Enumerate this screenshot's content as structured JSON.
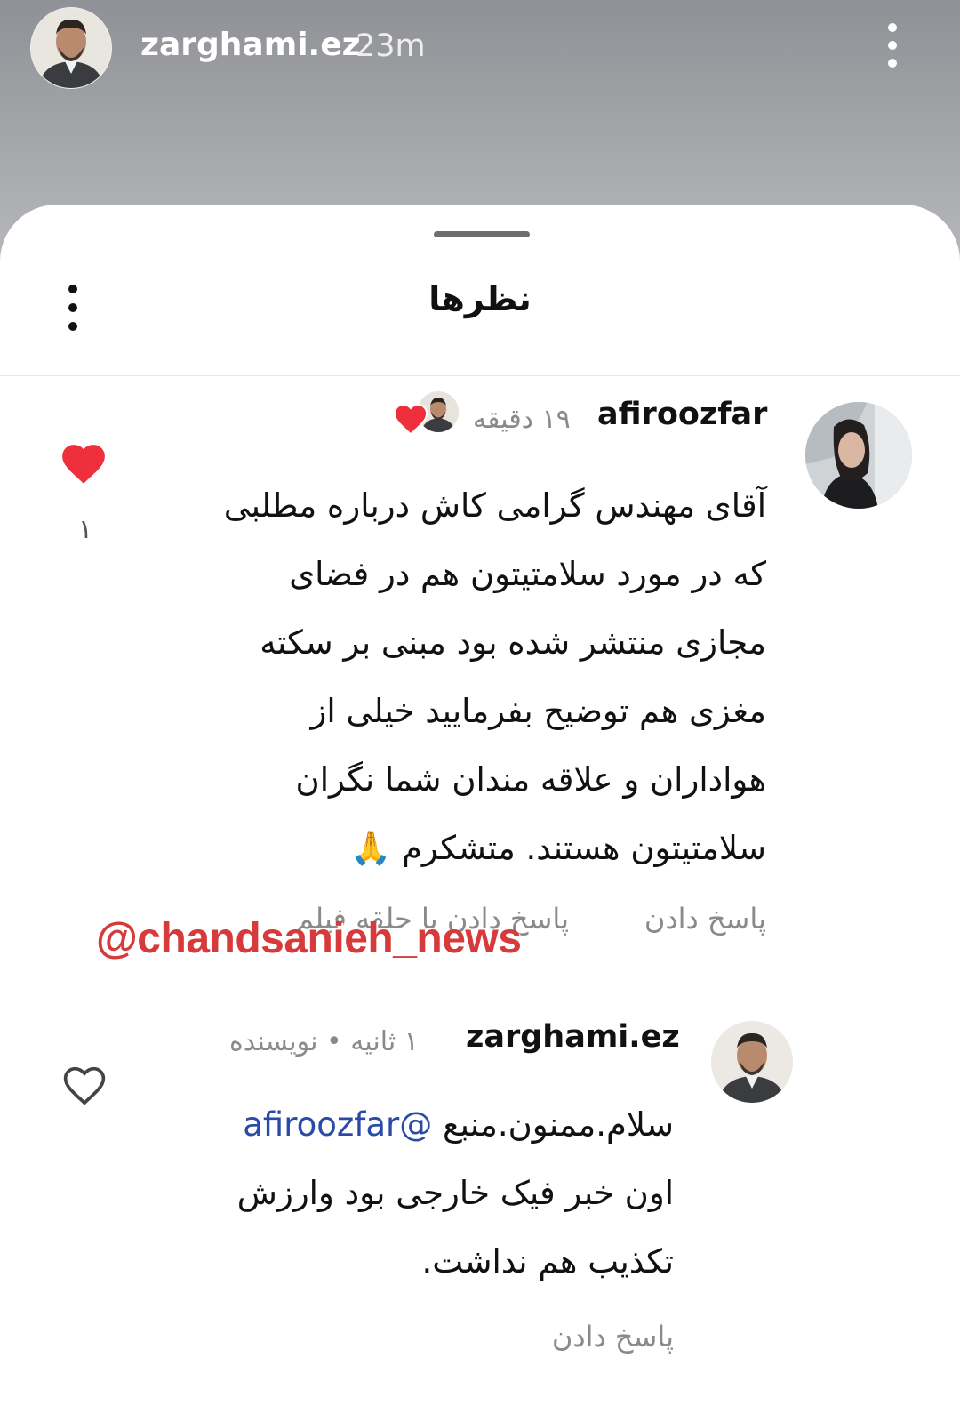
{
  "story": {
    "username": "zarghami.ez",
    "time": "23m"
  },
  "sheet": {
    "title": "نظرها"
  },
  "comments": [
    {
      "username": "afiroozfar",
      "meta": "۱۹ دقیقه",
      "lines": [
        "آقای مهندس گرامی کاش درباره مطلبی",
        "که در مورد سلامتیتون هم در فضای",
        "مجازی منتشر شده بود مبنی بر سکته",
        "مغزی هم توضیح بفرمایید خیلی از",
        "هواداران و علاقه مندان شما نگران",
        "سلامتیتون هستند.  متشکرم 🙏"
      ],
      "like_count": "۱",
      "reply_label": "پاسخ دادن",
      "reply_video_label": "پاسخ دادن با حلقه فیلم"
    },
    {
      "username": "zarghami.ez",
      "meta": "۱ ثانیه • نویسنده",
      "mention": "afiroozfar@",
      "lines": [
        "سلام.ممنون.منبع",
        "اون خبر فیک خارجی بود وارزش",
        "تکذیب هم نداشت."
      ],
      "reply_label": "پاسخ دادن"
    }
  ],
  "watermark": "@chandsanieh_news",
  "colors": {
    "heart": "#ef2f3c",
    "mention": "#2b4aa8",
    "watermark": "#d63a3a"
  }
}
